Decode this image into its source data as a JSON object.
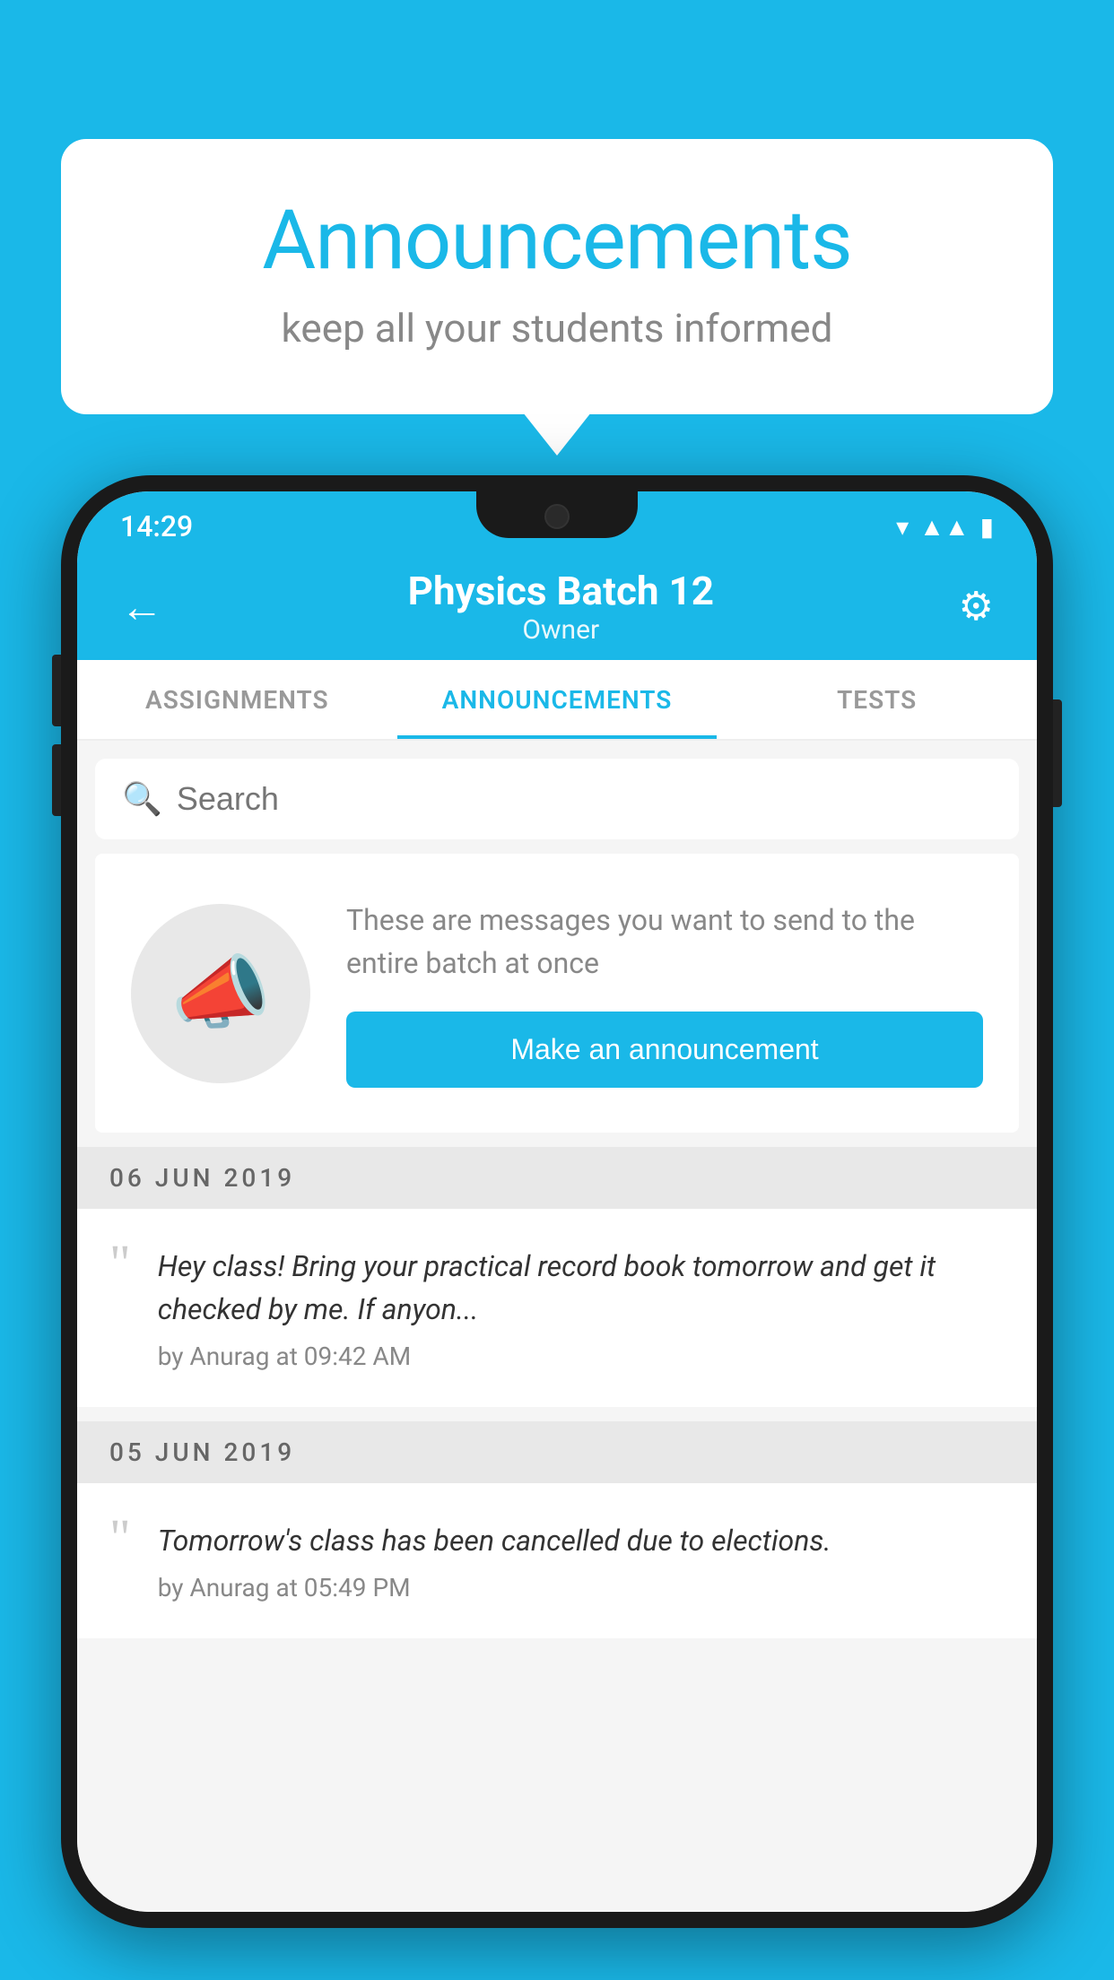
{
  "background_color": "#1ab8e8",
  "speech_bubble": {
    "title": "Announcements",
    "subtitle": "keep all your students informed"
  },
  "phone": {
    "status_bar": {
      "time": "14:29"
    },
    "header": {
      "title": "Physics Batch 12",
      "subtitle": "Owner",
      "back_label": "←",
      "gear_label": "⚙"
    },
    "tabs": [
      {
        "label": "ASSIGNMENTS",
        "active": false
      },
      {
        "label": "ANNOUNCEMENTS",
        "active": true
      },
      {
        "label": "TESTS",
        "active": false
      }
    ],
    "search": {
      "placeholder": "Search"
    },
    "announcement_prompt": {
      "description": "These are messages you want to send to the entire batch at once",
      "button_label": "Make an announcement"
    },
    "announcements": [
      {
        "date": "06  JUN  2019",
        "text": "Hey class! Bring your practical record book tomorrow and get it checked by me. If anyon...",
        "meta": "by Anurag at 09:42 AM"
      },
      {
        "date": "05  JUN  2019",
        "text": "Tomorrow's class has been cancelled due to elections.",
        "meta": "by Anurag at 05:49 PM"
      }
    ]
  }
}
